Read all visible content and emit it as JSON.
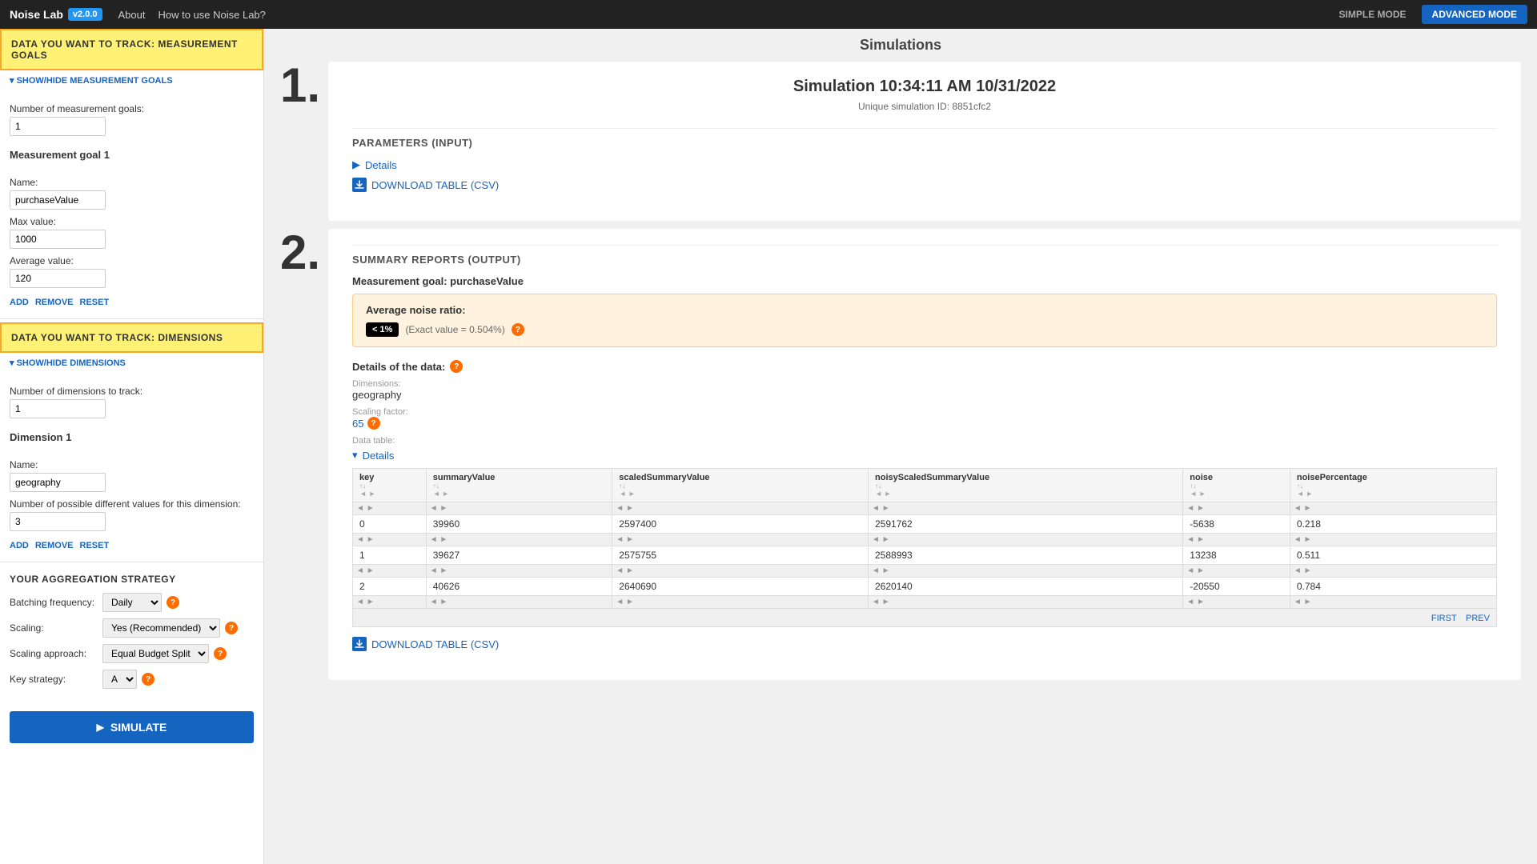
{
  "app": {
    "name": "Noise Lab",
    "version": "v2.0.0",
    "nav_links": [
      "About",
      "How to use Noise Lab?"
    ],
    "mode_simple": "SIMPLE MODE",
    "mode_advanced": "ADVANCED MODE"
  },
  "left_panel": {
    "section1_title": "DATA YOU WANT TO TRACK: MEASUREMENT GOALS",
    "show_hide_goals": "▾ SHOW/HIDE MEASUREMENT GOALS",
    "num_goals_label": "Number of measurement goals:",
    "num_goals_value": "1",
    "goal1_title": "Measurement goal 1",
    "goal1_name_label": "Name:",
    "goal1_name_value": "purchaseValue",
    "goal1_max_label": "Max value:",
    "goal1_max_value": "1000",
    "goal1_avg_label": "Average value:",
    "goal1_avg_value": "120",
    "add_label": "ADD",
    "remove_label": "REMOVE",
    "reset_label": "RESET",
    "section2_title": "DATA YOU WANT TO TRACK: DIMENSIONS",
    "show_hide_dims": "▾ SHOW/HIDE DIMENSIONS",
    "num_dims_label": "Number of dimensions to track:",
    "num_dims_value": "1",
    "dim1_title": "Dimension 1",
    "dim1_name_label": "Name:",
    "dim1_name_value": "geography",
    "dim1_possible_label": "Number of possible different values for this dimension:",
    "dim1_possible_value": "3",
    "add_label2": "ADD",
    "remove_label2": "REMOVE",
    "reset_label2": "RESET",
    "agg_title": "YOUR AGGREGATION STRATEGY",
    "batch_label": "Batching frequency:",
    "batch_value": "Daily",
    "scaling_label": "Scaling:",
    "scaling_value": "Yes (Recommended)",
    "scaling_approach_label": "Scaling approach:",
    "scaling_approach_value": "Equal Budget Split",
    "key_strategy_label": "Key strategy:",
    "key_strategy_value": "A",
    "simulate_label": "SIMULATE"
  },
  "right_panel": {
    "step1": "1.",
    "step2": "2.",
    "simulations_title": "Simulations",
    "sim_title": "Simulation 10:34:11 AM 10/31/2022",
    "sim_id": "Unique simulation ID: 8851cfc2",
    "params_title": "PARAMETERS (INPUT)",
    "details_label": "Details",
    "download_csv_label": "DOWNLOAD TABLE (CSV)",
    "summary_title": "SUMMARY REPORTS (OUTPUT)",
    "goal_label": "Measurement goal:",
    "goal_name": "purchaseValue",
    "avg_noise_label": "Average noise ratio:",
    "noise_badge": "< 1%",
    "exact_value": "(Exact value = 0.504%)",
    "details_of_data": "Details of the data:",
    "dimensions_label": "Dimensions:",
    "dimensions_value": "geography",
    "scaling_factor_label": "Scaling factor:",
    "scaling_factor_value": "65",
    "data_table_label": "Data table:",
    "table_details": "Details",
    "table_headers": [
      "key",
      "summaryValue",
      "scaledSummaryValue",
      "noisyScaledSummaryValue",
      "noise",
      "noisePercentage"
    ],
    "table_rows": [
      [
        "0",
        "39960",
        "2597400",
        "2591762",
        "-5638",
        "0.218"
      ],
      [
        "1",
        "39627",
        "2575755",
        "2588993",
        "13238",
        "0.511"
      ],
      [
        "2",
        "40626",
        "2640690",
        "2620140",
        "-20550",
        "0.784"
      ]
    ],
    "first_label": "FIRST",
    "prev_label": "PREV",
    "download_csv_bottom": "DOWNLOAD TABLE (CSV)"
  }
}
